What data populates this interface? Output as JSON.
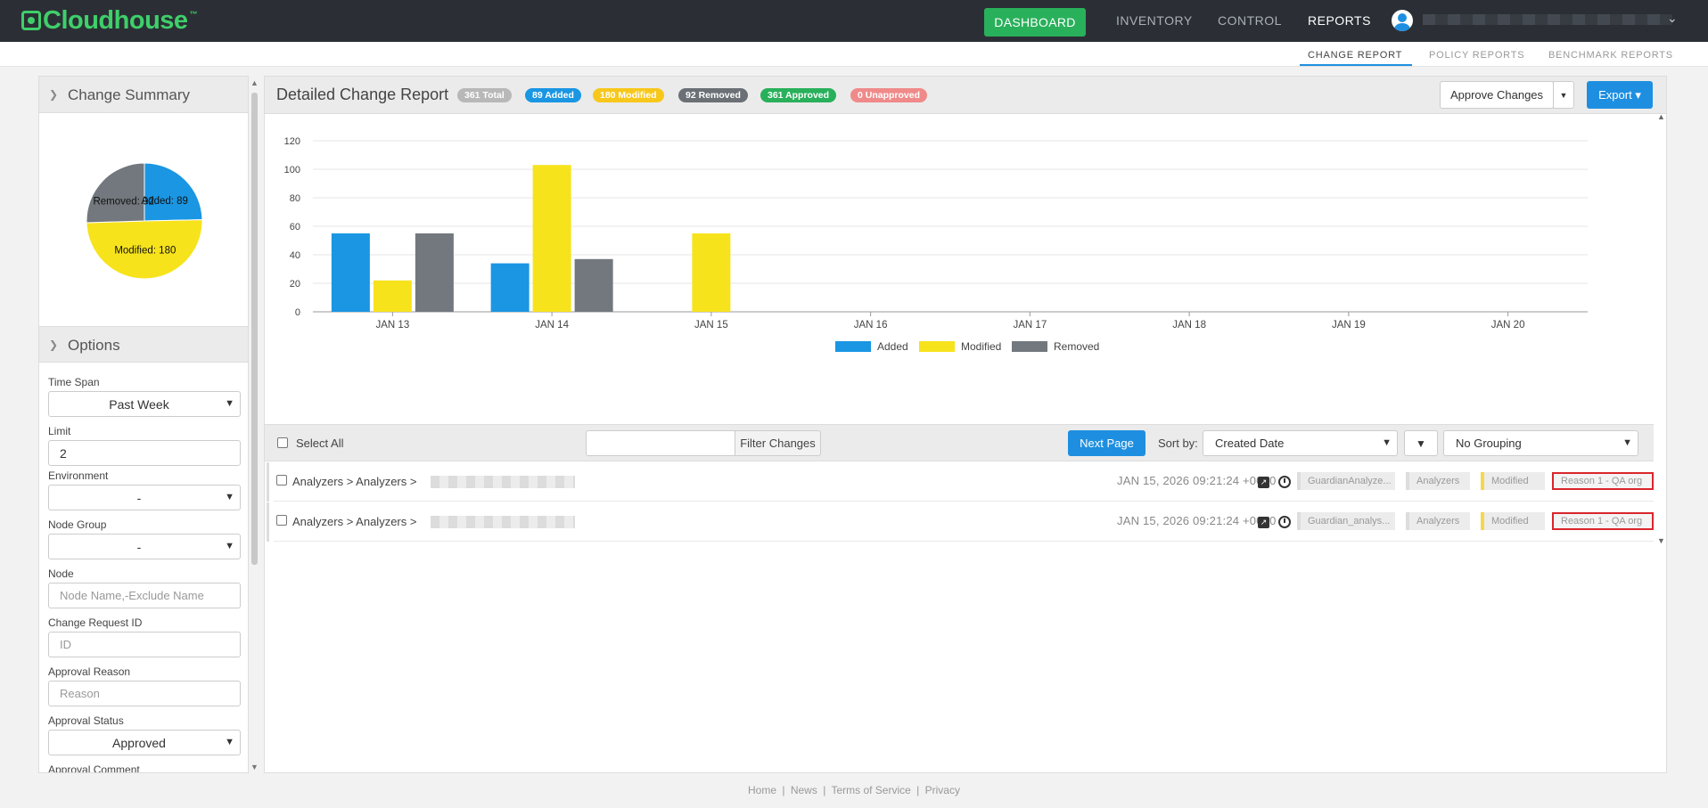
{
  "brand": {
    "name": "Cloudhouse",
    "tm": "™"
  },
  "topnav": {
    "dashboard": "DASHBOARD",
    "inventory": "INVENTORY",
    "control": "CONTROL",
    "reports": "REPORTS"
  },
  "subnav": {
    "change_report": "CHANGE REPORT",
    "policy_reports": "POLICY REPORTS",
    "benchmark_reports": "BENCHMARK REPORTS"
  },
  "sidebar": {
    "summary_title": "Change Summary",
    "options_title": "Options",
    "pie": {
      "slices": [
        {
          "name": "Added",
          "value": 89,
          "color": "#1a96e3",
          "label": "Added: 89"
        },
        {
          "name": "Modified",
          "value": 180,
          "color": "#f7e31c",
          "label": "Modified: 180"
        },
        {
          "name": "Removed",
          "value": 92,
          "color": "#72787e",
          "label": "Removed: 92"
        }
      ]
    },
    "fields": {
      "time_span_label": "Time Span",
      "time_span_value": "Past Week",
      "limit_label": "Limit",
      "limit_value": "2",
      "environment_label": "Environment",
      "environment_value": "-",
      "node_group_label": "Node Group",
      "node_group_value": "-",
      "node_label": "Node",
      "node_placeholder": "Node Name,-Exclude Name",
      "change_request_label": "Change Request ID",
      "change_request_placeholder": "ID",
      "approval_reason_label": "Approval Reason",
      "approval_reason_placeholder": "Reason",
      "approval_status_label": "Approval Status",
      "approval_status_value": "Approved",
      "approval_comment_label": "Approval Comment"
    }
  },
  "main": {
    "title": "Detailed Change Report",
    "badges": {
      "total": "361 Total",
      "added": "89 Added",
      "modified": "180 Modified",
      "removed": "92 Removed",
      "approved": "361 Approved",
      "unapproved": "0 Unapproved"
    },
    "approve_label": "Approve Changes",
    "export_label": "Export ▾",
    "toolbar": {
      "select_all": "Select All",
      "filter_placeholder": "",
      "filter_button": "Filter Changes",
      "next_page": "Next Page",
      "sort_label": "Sort by:",
      "sort_value": "Created Date",
      "sort_dir": "▼",
      "grouping_value": "No Grouping"
    },
    "rows": [
      {
        "path": "Analyzers > Analyzers >",
        "date": "JAN 15, 2026 09:21:24 +0000",
        "tag_name": "GuardianAnalyze...",
        "tag_category": "Analyzers",
        "tag_status": "Modified",
        "tag_reason": "Reason 1 - QA org"
      },
      {
        "path": "Analyzers > Analyzers >",
        "date": "JAN 15, 2026 09:21:24 +0000",
        "tag_name": "Guardian_analys...",
        "tag_category": "Analyzers",
        "tag_status": "Modified",
        "tag_reason": "Reason 1 - QA org"
      }
    ]
  },
  "chart_data": [
    {
      "type": "bar",
      "categories": [
        "JAN 13",
        "JAN 14",
        "JAN 15",
        "JAN 16",
        "JAN 17",
        "JAN 18",
        "JAN 19",
        "JAN 20"
      ],
      "series": [
        {
          "name": "Added",
          "color": "#1a96e3",
          "values": [
            55,
            34,
            0,
            0,
            0,
            0,
            0,
            0
          ]
        },
        {
          "name": "Modified",
          "color": "#f7e31c",
          "values": [
            22,
            103,
            55,
            0,
            0,
            0,
            0,
            0
          ]
        },
        {
          "name": "Removed",
          "color": "#72787e",
          "values": [
            55,
            37,
            0,
            0,
            0,
            0,
            0,
            0
          ]
        }
      ],
      "yticks": [
        "0",
        "20",
        "40",
        "60",
        "80",
        "100",
        "120"
      ],
      "ylim": [
        0,
        120
      ],
      "grid": true,
      "legend": "bottom-center"
    },
    {
      "type": "pie",
      "categories": [
        "Added",
        "Modified",
        "Removed"
      ],
      "values": [
        89,
        180,
        92
      ]
    }
  ],
  "footer": {
    "home": "Home",
    "news": "News",
    "terms": "Terms of Service",
    "privacy": "Privacy",
    "sep": "|"
  }
}
